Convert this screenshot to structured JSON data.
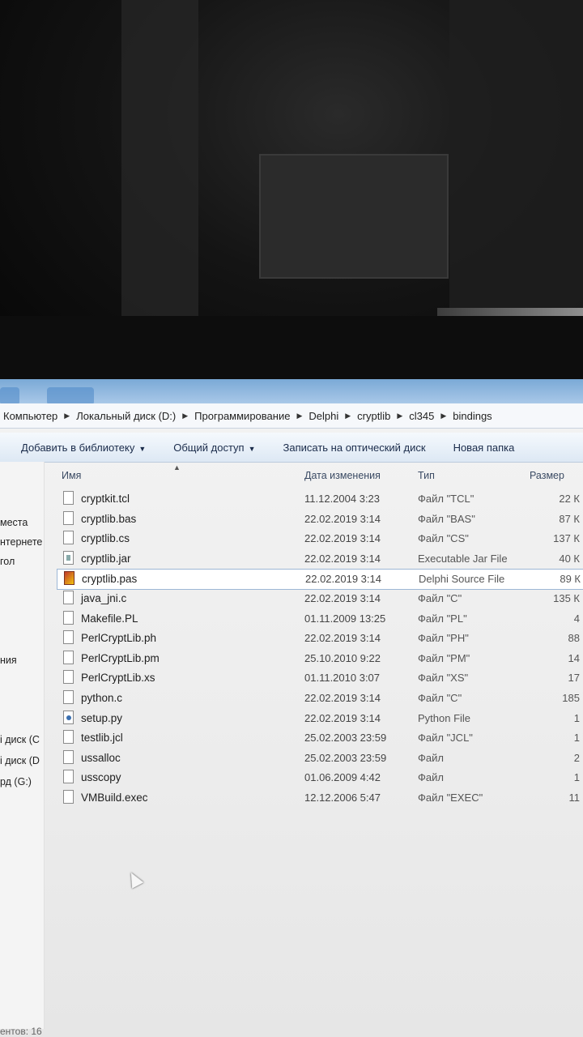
{
  "breadcrumb": [
    "Компьютер",
    "Локальный диск (D:)",
    "Программирование",
    "Delphi",
    "cryptlib",
    "cl345",
    "bindings"
  ],
  "toolbar": {
    "add_library": "Добавить в библиотеку",
    "share": "Общий доступ",
    "burn": "Записать на оптический диск",
    "new_folder": "Новая папка"
  },
  "sidebar": [
    "места",
    "нтернете",
    "гол",
    "ния",
    "і диск (C",
    "і диск (D",
    "рд (G:)"
  ],
  "columns": {
    "name": "Имя",
    "date": "Дата изменения",
    "type": "Тип",
    "size": "Размер"
  },
  "files": [
    {
      "name": "cryptkit.tcl",
      "date": "11.12.2004 3:23",
      "type": "Файл \"TCL\"",
      "size": "22 К",
      "icon": "file-icon"
    },
    {
      "name": "cryptlib.bas",
      "date": "22.02.2019 3:14",
      "type": "Файл \"BAS\"",
      "size": "87 К",
      "icon": "file-icon"
    },
    {
      "name": "cryptlib.cs",
      "date": "22.02.2019 3:14",
      "type": "Файл \"CS\"",
      "size": "137 К",
      "icon": "file-icon"
    },
    {
      "name": "cryptlib.jar",
      "date": "22.02.2019 3:14",
      "type": "Executable Jar File",
      "size": "40 К",
      "icon": "jar-file-icon"
    },
    {
      "name": "cryptlib.pas",
      "date": "22.02.2019 3:14",
      "type": "Delphi Source File",
      "size": "89 К",
      "icon": "delphi-file-icon",
      "selected": true
    },
    {
      "name": "java_jni.c",
      "date": "22.02.2019 3:14",
      "type": "Файл \"C\"",
      "size": "135 К",
      "icon": "file-icon"
    },
    {
      "name": "Makefile.PL",
      "date": "01.11.2009 13:25",
      "type": "Файл \"PL\"",
      "size": "4",
      "icon": "file-icon"
    },
    {
      "name": "PerlCryptLib.ph",
      "date": "22.02.2019 3:14",
      "type": "Файл \"PH\"",
      "size": "88",
      "icon": "file-icon"
    },
    {
      "name": "PerlCryptLib.pm",
      "date": "25.10.2010 9:22",
      "type": "Файл \"PM\"",
      "size": "14",
      "icon": "file-icon"
    },
    {
      "name": "PerlCryptLib.xs",
      "date": "01.11.2010 3:07",
      "type": "Файл \"XS\"",
      "size": "17",
      "icon": "file-icon"
    },
    {
      "name": "python.c",
      "date": "22.02.2019 3:14",
      "type": "Файл \"C\"",
      "size": "185",
      "icon": "file-icon"
    },
    {
      "name": "setup.py",
      "date": "22.02.2019 3:14",
      "type": "Python File",
      "size": "1",
      "icon": "python-file-icon"
    },
    {
      "name": "testlib.jcl",
      "date": "25.02.2003 23:59",
      "type": "Файл \"JCL\"",
      "size": "1",
      "icon": "file-icon"
    },
    {
      "name": "ussalloc",
      "date": "25.02.2003 23:59",
      "type": "Файл",
      "size": "2",
      "icon": "file-icon"
    },
    {
      "name": "usscopy",
      "date": "01.06.2009 4:42",
      "type": "Файл",
      "size": "1",
      "icon": "file-icon"
    },
    {
      "name": "VMBuild.exec",
      "date": "12.12.2006 5:47",
      "type": "Файл \"EXEC\"",
      "size": "11",
      "icon": "file-icon"
    }
  ],
  "status": "ентов: 16"
}
